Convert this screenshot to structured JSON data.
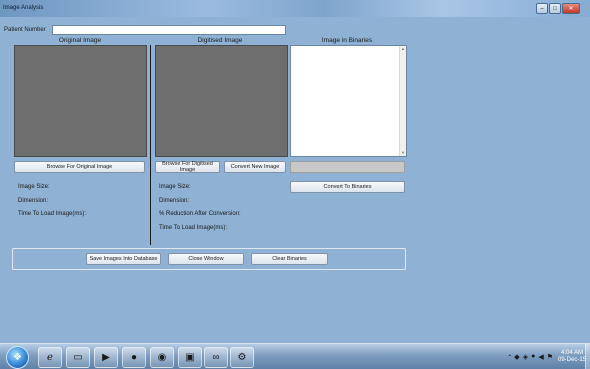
{
  "window": {
    "title": "Image Analysis"
  },
  "form": {
    "patient_number_label": "Patient Number",
    "patient_number_value": ""
  },
  "original": {
    "header": "Original Image",
    "browse_button": "Browse For Original Image",
    "image_size_label": "Image Size:",
    "dimension_label": "Dimension:",
    "time_label": "Time To Load Image(ms):"
  },
  "digitised": {
    "header": "Digitised Image",
    "browse_button": "Browse For Digitised Image",
    "convert_button": "Convert New Image",
    "image_size_label": "Image Size:",
    "dimension_label": "Dimension:",
    "reduction_label": "% Reduction After Conversion:",
    "time_label": "Time To Load Image(ms):"
  },
  "binaries": {
    "header": "Image in Binaries",
    "content": "",
    "convert_button": "Convert To Binaries"
  },
  "actions": {
    "save_button": "Save Images Into Database",
    "close_button": "Close Window",
    "clear_button": "Clear Binaries"
  },
  "taskbar": {
    "time": "4:04 AM",
    "date": "09-Dec-15"
  }
}
